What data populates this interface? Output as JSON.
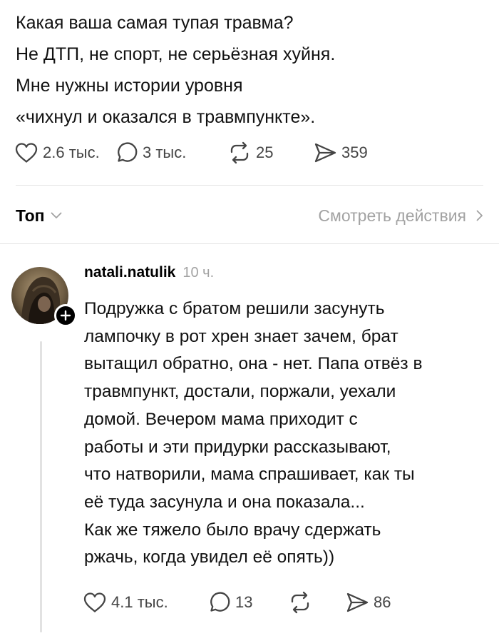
{
  "post": {
    "lines": [
      "Какая ваша самая тупая травма?",
      "Не ДТП, не спорт, не серьёзная хуйня.",
      "Мне нужны истории уровня",
      "«чихнул и оказался в травмпункте»."
    ],
    "stats": {
      "likes": "2.6 тыс.",
      "replies": "3 тыс.",
      "reposts": "25",
      "shares": "359"
    }
  },
  "sort": {
    "label": "Топ",
    "view_activity": "Смотреть действия"
  },
  "comment": {
    "username": "natali.natulik",
    "time": "10 ч.",
    "lines": [
      "Подружка с братом решили засунуть",
      "лампочку в рот хрен знает зачем, брат",
      "вытащил обратно, она - нет. Папа отвёз в",
      "травмпункт, достали, поржали, уехали",
      "домой. Вечером мама приходит с",
      "работы и эти придурки рассказывают,",
      "что натворили, мама спрашивает, как ты",
      "её туда засунула и она показала...",
      "Как же тяжело было врачу сдержать",
      "ржачь, когда увидел её опять))"
    ],
    "stats": {
      "likes": "4.1 тыс.",
      "replies": "13",
      "shares": "86"
    }
  },
  "icons": {
    "like": "heart-icon",
    "reply": "speech-bubble-icon",
    "repost": "repost-icon",
    "share": "send-icon",
    "sort_chevron": "chevron-down-icon",
    "activity_chevron": "chevron-right-icon",
    "follow": "plus-icon"
  },
  "colors": {
    "icon": "#444444",
    "muted": "#a2a2a2",
    "divider": "#e4e4e4",
    "badge": "#000000"
  }
}
